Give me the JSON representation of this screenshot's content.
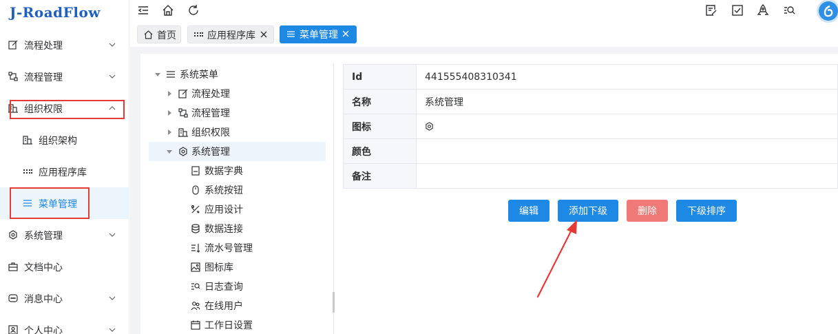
{
  "app": {
    "logo": "J-RoadFlow"
  },
  "sidebar": {
    "items": [
      {
        "label": "流程处理",
        "icon": "edit-icon"
      },
      {
        "label": "流程管理",
        "icon": "flow-icon"
      },
      {
        "label": "组织权限",
        "icon": "building-icon",
        "expanded": true
      },
      {
        "label": "组织架构",
        "icon": "building-icon"
      },
      {
        "label": "应用程序库",
        "icon": "grid-icon"
      },
      {
        "label": "菜单管理",
        "icon": "menu-icon",
        "active": true
      },
      {
        "label": "系统管理",
        "icon": "gear-icon"
      },
      {
        "label": "文档中心",
        "icon": "briefcase-icon"
      },
      {
        "label": "消息中心",
        "icon": "message-icon"
      },
      {
        "label": "个人中心",
        "icon": "user-card-icon"
      }
    ]
  },
  "topbar": {
    "icons": [
      "collapse-icon",
      "home-icon",
      "refresh-icon",
      "edit-note-icon",
      "checkbox-icon",
      "rocket-icon",
      "search-list-icon",
      "avatar"
    ]
  },
  "tabs": [
    {
      "label": "首页",
      "icon": "home-icon"
    },
    {
      "label": "应用程序库",
      "icon": "grid-icon",
      "closable": true
    },
    {
      "label": "菜单管理",
      "icon": "menu-icon",
      "closable": true,
      "active": true
    }
  ],
  "tree": {
    "root": "系统菜单",
    "nodes": [
      {
        "label": "流程处理",
        "icon": "edit-icon"
      },
      {
        "label": "流程管理",
        "icon": "flow-icon"
      },
      {
        "label": "组织权限",
        "icon": "building-icon"
      },
      {
        "label": "系统管理",
        "icon": "gear-icon",
        "expanded": true,
        "selected": true
      },
      {
        "label": "数据字典",
        "icon": "book-icon"
      },
      {
        "label": "系统按钮",
        "icon": "mouse-icon"
      },
      {
        "label": "应用设计",
        "icon": "tools-icon"
      },
      {
        "label": "数据连接",
        "icon": "database-icon"
      },
      {
        "label": "流水号管理",
        "icon": "sort-number-icon"
      },
      {
        "label": "图标库",
        "icon": "image-icon"
      },
      {
        "label": "日志查询",
        "icon": "log-search-icon"
      },
      {
        "label": "在线用户",
        "icon": "users-icon"
      },
      {
        "label": "工作日设置",
        "icon": "calendar-icon"
      }
    ]
  },
  "detail": {
    "rows": [
      {
        "key": "Id",
        "value": "441555408310341"
      },
      {
        "key": "名称",
        "value": "系统管理"
      },
      {
        "key": "图标",
        "value": "",
        "icon": "gear-icon"
      },
      {
        "key": "颜色",
        "value": ""
      },
      {
        "key": "备注",
        "value": ""
      }
    ]
  },
  "actions": {
    "edit": "编辑",
    "add_child": "添加下级",
    "delete": "删除",
    "sort_children": "下级排序"
  },
  "colors": {
    "primary": "#1e88e5",
    "danger": "#f07a78",
    "annotation": "#e53935",
    "logo": "#1e5fbf"
  }
}
